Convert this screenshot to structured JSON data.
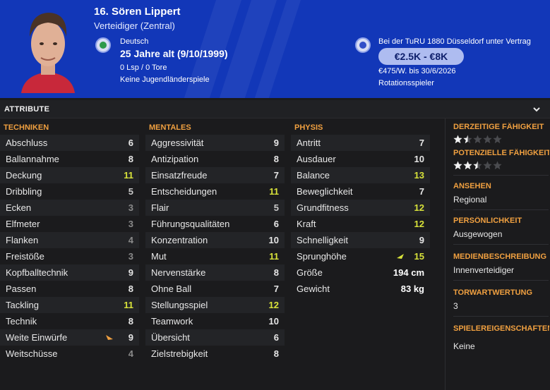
{
  "header": {
    "name": "16. Sören Lippert",
    "position": "Verteidiger (Zentral)",
    "nationality": "Deutsch",
    "age": "25 Jahre alt (9/10/1999)",
    "caps": "0 Lsp / 0 Tore",
    "youth_caps": "Keine Jugendländerspiele",
    "contract_status": "Bei der TuRU 1880 Düsseldorf unter Vertrag",
    "value_range": "€2.5K - €8K",
    "wage_contract": "€475/W. bis 30/6/2026",
    "squad_status": "Rotationsspieler",
    "colors": {
      "background": "#1237b8",
      "badge": "#aebcf0"
    }
  },
  "attributes_bar": {
    "title": "ATTRIBUTE",
    "icon": "chevron-down-icon"
  },
  "technical": {
    "title": "TECHNIKEN",
    "rows": [
      {
        "name": "Abschluss",
        "value": "6"
      },
      {
        "name": "Ballannahme",
        "value": "8"
      },
      {
        "name": "Deckung",
        "value": "11"
      },
      {
        "name": "Dribbling",
        "value": "5"
      },
      {
        "name": "Ecken",
        "value": "3"
      },
      {
        "name": "Elfmeter",
        "value": "3"
      },
      {
        "name": "Flanken",
        "value": "4"
      },
      {
        "name": "Freistöße",
        "value": "3"
      },
      {
        "name": "Kopfballtechnik",
        "value": "9"
      },
      {
        "name": "Passen",
        "value": "8"
      },
      {
        "name": "Tackling",
        "value": "11"
      },
      {
        "name": "Technik",
        "value": "8"
      },
      {
        "name": "Weite Einwürfe",
        "value": "9"
      },
      {
        "name": "Weitschüsse",
        "value": "4"
      }
    ]
  },
  "mental": {
    "title": "MENTALES",
    "rows": [
      {
        "name": "Aggressivität",
        "value": "9"
      },
      {
        "name": "Antizipation",
        "value": "8"
      },
      {
        "name": "Einsatzfreude",
        "value": "7"
      },
      {
        "name": "Entscheidungen",
        "value": "11"
      },
      {
        "name": "Flair",
        "value": "5"
      },
      {
        "name": "Führungsqualitäten",
        "value": "6"
      },
      {
        "name": "Konzentration",
        "value": "10"
      },
      {
        "name": "Mut",
        "value": "11"
      },
      {
        "name": "Nervenstärke",
        "value": "8"
      },
      {
        "name": "Ohne Ball",
        "value": "7"
      },
      {
        "name": "Stellungsspiel",
        "value": "12"
      },
      {
        "name": "Teamwork",
        "value": "10"
      },
      {
        "name": "Übersicht",
        "value": "6"
      },
      {
        "name": "Zielstrebigkeit",
        "value": "8"
      }
    ]
  },
  "physical": {
    "title": "PHYSIS",
    "rows": [
      {
        "name": "Antritt",
        "value": "7"
      },
      {
        "name": "Ausdauer",
        "value": "10"
      },
      {
        "name": "Balance",
        "value": "13"
      },
      {
        "name": "Beweglichkeit",
        "value": "7"
      },
      {
        "name": "Grundfitness",
        "value": "12"
      },
      {
        "name": "Kraft",
        "value": "12"
      },
      {
        "name": "Schnelligkeit",
        "value": "9"
      },
      {
        "name": "Sprunghöhe",
        "value": "15"
      }
    ],
    "height_label": "Größe",
    "height_value": "194 cm",
    "weight_label": "Gewicht",
    "weight_value": "83 kg"
  },
  "side": {
    "current_ability": {
      "title": "DERZEITIGE FÄHIGKEIT",
      "stars": 1.5,
      "max": 5
    },
    "potential_ability": {
      "title": "POTENZIELLE FÄHIGKEIT",
      "stars": 2.5,
      "max": 5
    },
    "reputation": {
      "title": "ANSEHEN",
      "value": "Regional"
    },
    "personality": {
      "title": "PERSÖNLICHKEIT",
      "value": "Ausgewogen"
    },
    "media": {
      "title": "MEDIENBESCHREIBUNG",
      "value": "Innenverteidiger"
    },
    "goalkeeper": {
      "title": "TORWARTWERTUNG",
      "value": "3"
    },
    "traits": {
      "title": "SPIELEREIGENSCHAFTEN",
      "value": "Keine"
    }
  }
}
